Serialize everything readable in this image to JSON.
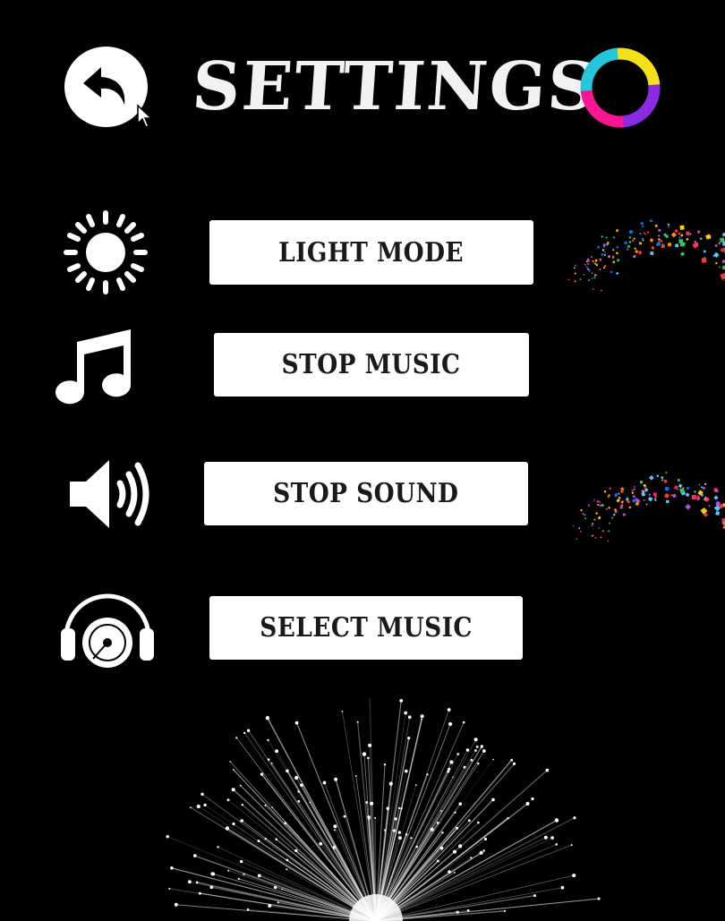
{
  "header": {
    "title": "SETTINGS",
    "back_icon": "undo-arrow-icon",
    "theme_ring_colors": [
      "#f5e11a",
      "#8a2be2",
      "#ff1493",
      "#26c6da"
    ]
  },
  "menu": {
    "items": [
      {
        "icon": "sun-icon",
        "label": "LIGHT MODE"
      },
      {
        "icon": "music-note-icon",
        "label": "STOP MUSIC"
      },
      {
        "icon": "speaker-icon",
        "label": "STOP SOUND"
      },
      {
        "icon": "headphones-icon",
        "label": "SELECT MUSIC"
      }
    ]
  },
  "colors": {
    "background": "#000000",
    "button_bg": "#ffffff",
    "button_text": "#1a1a1a"
  }
}
